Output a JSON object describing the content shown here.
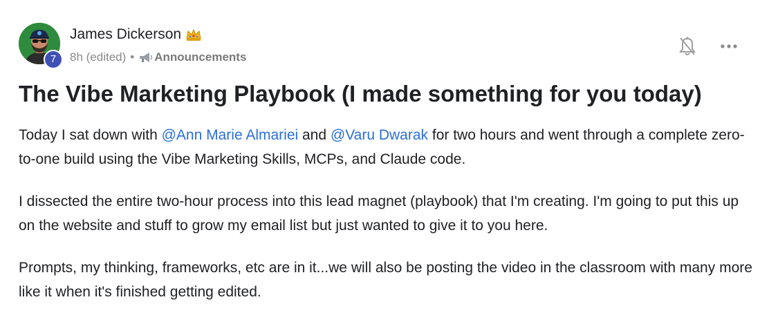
{
  "post": {
    "author": {
      "name": "James Dickerson",
      "level": "7",
      "badge_icon": "crown-icon"
    },
    "meta": {
      "time": "8h (edited)",
      "separator": "•",
      "category": "Announcements",
      "category_icon": "megaphone-icon"
    },
    "actions": {
      "notify_icon": "bell-off-icon",
      "more_icon": "more-options-icon"
    },
    "title": "The Vibe Marketing Playbook (I made something for you today)",
    "paragraphs": [
      {
        "p1_text_a": "Today I sat down with ",
        "mention_1": "@Ann Marie Almariei",
        "p1_text_b": " and ",
        "mention_2": "@Varu Dwarak",
        "p1_text_c": " for two hours and went through a complete zero-to-one build using the Vibe Marketing Skills, MCPs, and Claude code."
      },
      {
        "text": "I dissected the entire two-hour process into this lead magnet (playbook) that I'm creating. I'm going to put this up on the website and stuff to grow my email list but just wanted to give it to you here."
      },
      {
        "text": "Prompts, my thinking, frameworks, etc are in it...we will also be posting the video in the classroom with many more like it when it's finished getting edited."
      }
    ],
    "colors": {
      "mention": "#2a6fdb",
      "level_badge": "#3f51b5",
      "text": "#202124",
      "meta": "#8a8a8a"
    }
  }
}
